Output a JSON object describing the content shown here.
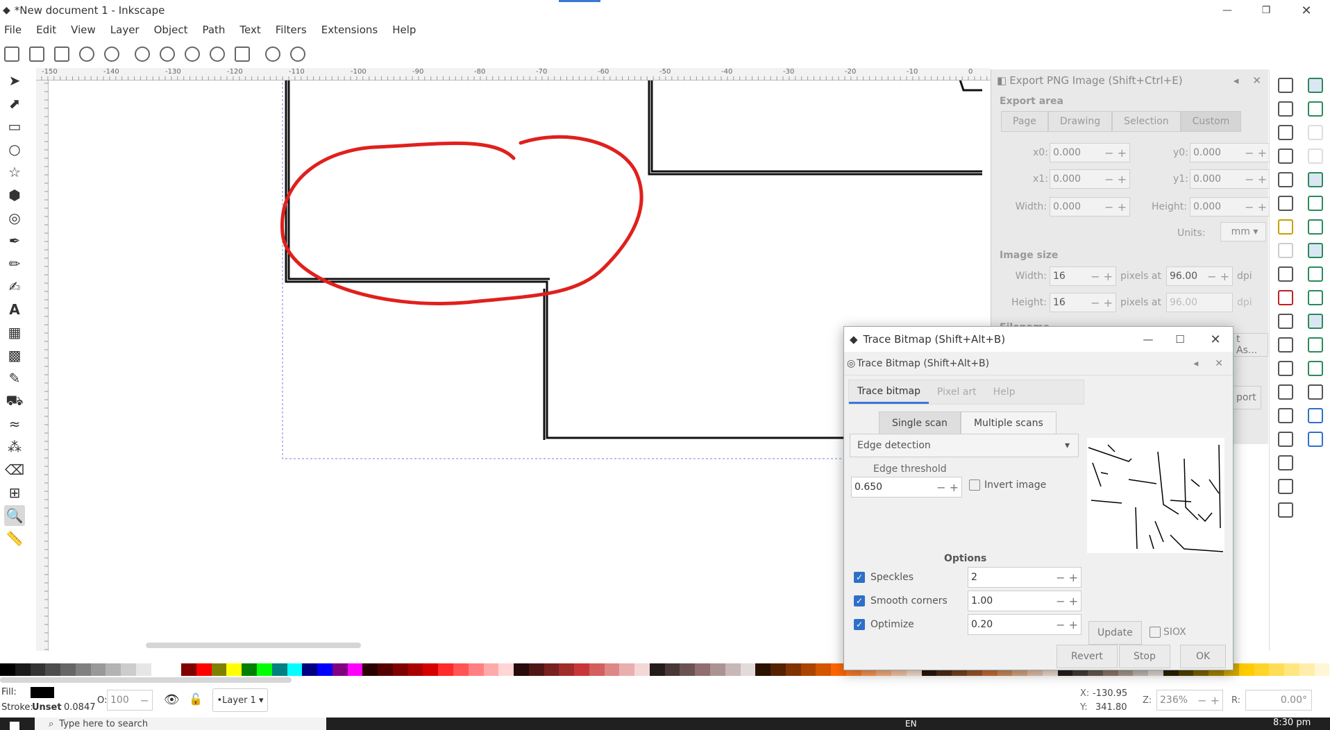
{
  "window": {
    "title": "*New document 1 - Inkscape"
  },
  "menu": [
    "File",
    "Edit",
    "View",
    "Layer",
    "Object",
    "Path",
    "Text",
    "Filters",
    "Extensions",
    "Help"
  ],
  "ruler": {
    "ticks": [
      "-150",
      "-140",
      "-130",
      "-120",
      "-110",
      "-100",
      "-90",
      "-80",
      "-70",
      "-60",
      "-50",
      "-40",
      "-30",
      "-20",
      "-10",
      "0"
    ]
  },
  "export_panel": {
    "title": "Export PNG Image (Shift+Ctrl+E)",
    "export_area_label": "Export area",
    "area_buttons": [
      "Page",
      "Drawing",
      "Selection",
      "Custom"
    ],
    "x0_label": "x0:",
    "x0": "0.000",
    "y0_label": "y0:",
    "y0": "0.000",
    "x1_label": "x1:",
    "x1": "0.000",
    "y1_label": "y1:",
    "y1": "0.000",
    "width_label": "Width:",
    "width": "0.000",
    "height_label": "Height:",
    "height": "0.000",
    "units_label": "Units:",
    "units": "mm",
    "image_size_label": "Image size",
    "img_width_label": "Width:",
    "img_width": "16",
    "img_height_label": "Height:",
    "img_height": "16",
    "pixels_at": "pixels at",
    "dpi_value": "96.00",
    "dpi_value2": "96.00",
    "dpi": "dpi",
    "filename_label": "Filename",
    "export_as": "t As...",
    "export_btn": "port"
  },
  "trace": {
    "window_title": "Trace Bitmap (Shift+Alt+B)",
    "panel_title": "Trace Bitmap (Shift+Alt+B)",
    "tabs": [
      "Trace bitmap",
      "Pixel art",
      "Help"
    ],
    "scan_modes": [
      "Single scan",
      "Multiple scans"
    ],
    "mode": "Edge detection",
    "threshold_label": "Edge threshold",
    "threshold": "0.650",
    "invert_label": "Invert image",
    "options_label": "Options",
    "speckles_label": "Speckles",
    "speckles": "2",
    "smooth_label": "Smooth corners",
    "smooth": "1.00",
    "optimize_label": "Optimize",
    "optimize": "0.20",
    "update": "Update",
    "siox": "SIOX",
    "revert": "Revert",
    "stop": "Stop",
    "ok": "OK"
  },
  "status": {
    "fill_label": "Fill:",
    "stroke_label": "Stroke:",
    "stroke_value": "Unset",
    "stroke_width": "0.0847",
    "opacity_label": "O:",
    "opacity": "100",
    "layer": "•Layer 1",
    "x_label": "X:",
    "x": "-130.95",
    "y_label": "Y:",
    "y": "341.80",
    "zoom_label": "Z:",
    "zoom": "236%",
    "rotate_label": "R:",
    "rotate": "0.00°"
  },
  "taskbar": {
    "search": "Type here to search",
    "lang": "EN",
    "time": "8:30 pm"
  },
  "colors": {
    "accent": "#3a78d6",
    "annotation": "#e0201d"
  }
}
